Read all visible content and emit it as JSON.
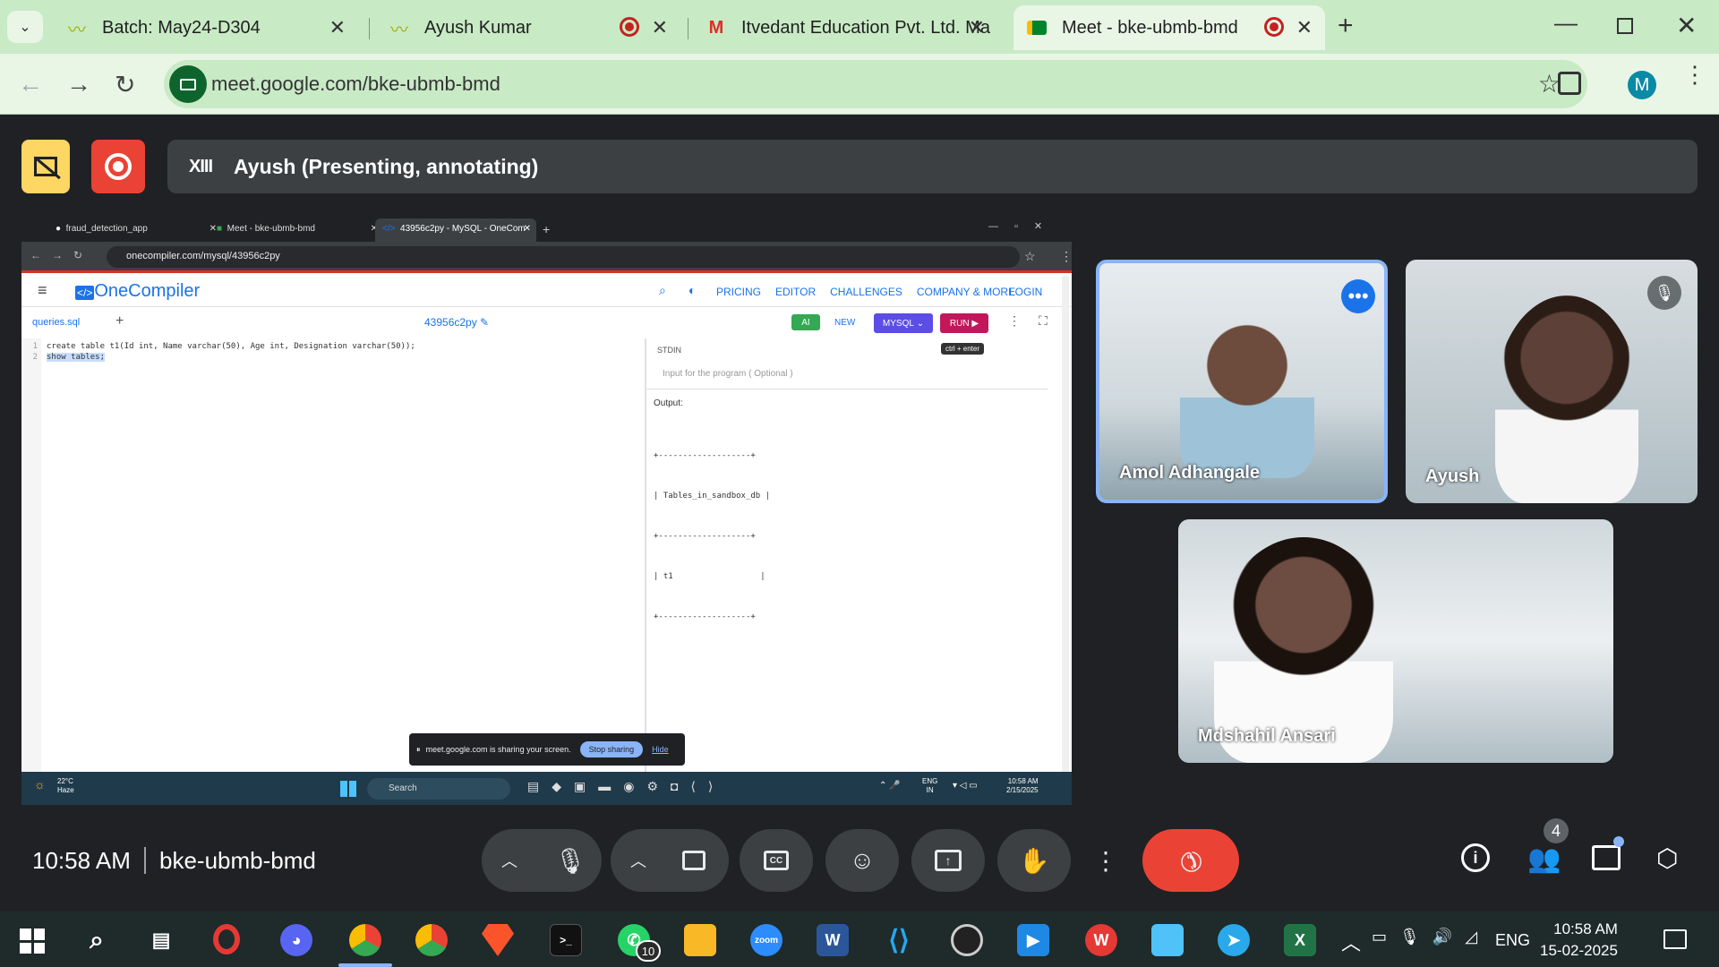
{
  "browser": {
    "tabs": [
      {
        "title": "Batch: May24-D304",
        "icon": "waveform-icon"
      },
      {
        "title": "Ayush Kumar",
        "icon": "waveform-icon"
      },
      {
        "title": "Itvedant Education Pvt. Ltd. Ma",
        "icon": "gmail-icon"
      },
      {
        "title": "Meet - bke-ubmb-bmd",
        "icon": "meet-icon"
      }
    ],
    "url": "meet.google.com/bke-ubmb-bmd",
    "profile_initial": "M"
  },
  "meet": {
    "presenter_label": "Ayush (Presenting, annotating)",
    "presenter_badge": "XIII",
    "time": "10:58 AM",
    "meeting_code": "bke-ubmb-bmd",
    "participants_count": "4",
    "participants": [
      {
        "name": "Amol Adhangale",
        "speaking": true
      },
      {
        "name": "Ayush",
        "muted": true
      },
      {
        "name": "Mdshahil Ansari"
      }
    ]
  },
  "shared_screen": {
    "tabs": [
      {
        "title": "fraud_detection_app"
      },
      {
        "title": "Meet - bke-ubmb-bmd"
      },
      {
        "title": "43956c2py - MySQL - OneCom"
      }
    ],
    "url": "onecompiler.com/mysql/43956c2py",
    "site": {
      "brand": "OneCompiler",
      "nav": [
        "PRICING",
        "EDITOR",
        "CHALLENGES",
        "COMPANY & MORE"
      ],
      "login": "LOGIN",
      "file_tab": "queries.sql",
      "project_id": "43956c2py",
      "ai_label": "AI",
      "new_label": "NEW",
      "lang_label": "MYSQL",
      "run_label": "RUN",
      "run_tooltip": "ctrl + enter",
      "stdin_label": "STDIN",
      "stdin_placeholder": "Input for the program ( Optional )",
      "output_label": "Output:",
      "output_lines": [
        "+-------------------+",
        "| Tables_in_sandbox_db |",
        "+-------------------+",
        "| t1                  |",
        "+-------------------+"
      ],
      "code_lines": [
        {
          "num": "1",
          "text": "create table t1(Id int, Name varchar(50), Age int, Designation varchar(50));"
        },
        {
          "num": "2",
          "text": "show tables;"
        }
      ]
    },
    "share_notice": "meet.google.com is sharing your screen.",
    "stop_sharing": "Stop sharing",
    "hide": "Hide",
    "taskbar": {
      "weather_temp": "22°C",
      "weather_desc": "Haze",
      "search": "Search",
      "lang": "ENG",
      "region": "IN",
      "time": "10:58 AM",
      "date": "2/15/2025"
    }
  },
  "taskbar": {
    "lang": "ENG",
    "time": "10:58 AM",
    "date": "15-02-2025",
    "whatsapp_badge": "10"
  }
}
